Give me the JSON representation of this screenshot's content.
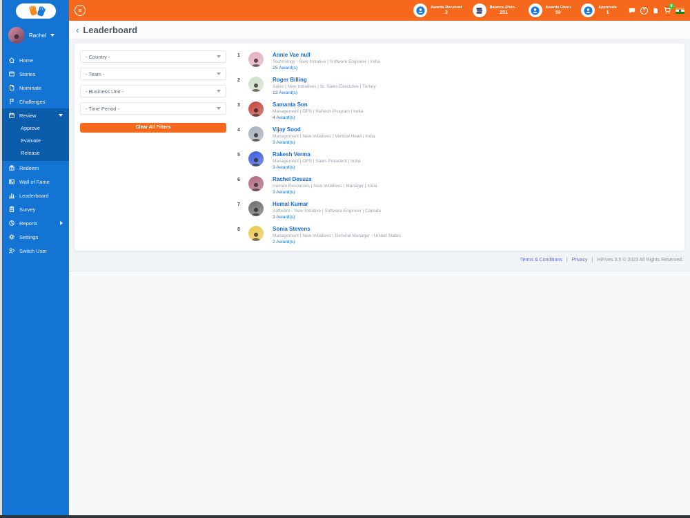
{
  "colors": {
    "accent_orange": "#F6681C",
    "sidebar_blue": "#1474D4",
    "sidebar_active_blue": "#0B5CAB",
    "link_blue": "#1B75D0",
    "page_bg": "#F1F4F7",
    "cart_badge_green": "#2ECC40"
  },
  "sidebar": {
    "user": {
      "name": "Rachel"
    },
    "items": [
      {
        "label": "Home",
        "icon": "home"
      },
      {
        "label": "Stories",
        "icon": "stories"
      },
      {
        "label": "Nominate",
        "icon": "nominate"
      },
      {
        "label": "Challenges",
        "icon": "challenges"
      },
      {
        "label": "Review",
        "icon": "review",
        "expanded": true,
        "children": [
          "Approve",
          "Evaluate",
          "Release"
        ]
      },
      {
        "label": "Redeem",
        "icon": "redeem"
      },
      {
        "label": "Wall of Fame",
        "icon": "wall-of-fame"
      },
      {
        "label": "Leaderboard",
        "icon": "leaderboard"
      },
      {
        "label": "Survey",
        "icon": "survey"
      },
      {
        "label": "Reports",
        "icon": "reports",
        "has_submenu": true
      },
      {
        "label": "Settings",
        "icon": "settings"
      },
      {
        "label": "Switch User",
        "icon": "switch-user"
      }
    ]
  },
  "topbar": {
    "stats": [
      {
        "label": "Awards Received",
        "value": "3",
        "icon": "medal"
      },
      {
        "label": "Balance (Poin...",
        "value": "251",
        "icon": "coins"
      },
      {
        "label": "Awards Given",
        "value": "59",
        "icon": "medal"
      },
      {
        "label": "Approvals",
        "value": "1",
        "icon": "medal"
      }
    ],
    "quick_icons": [
      "chat",
      "help",
      "document",
      "cart",
      "flag-india"
    ],
    "cart_badge": "9"
  },
  "page": {
    "title": "Leaderboard",
    "back_chevron": "‹"
  },
  "filters": {
    "selects": [
      {
        "name": "country",
        "value": "- Country -"
      },
      {
        "name": "team",
        "value": "- Team -"
      },
      {
        "name": "business-unit",
        "value": "- Business Unit -"
      },
      {
        "name": "time-period",
        "value": "- Time Period -"
      }
    ],
    "clear_button": "Clear All Filters"
  },
  "leaderboard": [
    {
      "rank": "1",
      "name": "Annie Vae null",
      "detail": "Technology - New Initiative | Software Engineer | India",
      "awards": "25 Award(s)",
      "avatar_color": "#e3aec2"
    },
    {
      "rank": "2",
      "name": "Roger Billing",
      "detail": "Sales | New Initiatives | Sr. Sales Executive | Turkey",
      "awards": "13 Award(s)",
      "avatar_color": "#cfe0cb"
    },
    {
      "rank": "3",
      "name": "Samanta Son",
      "detail": "Management | OPS | Refresh Program | India",
      "awards": "4 Award(s)",
      "avatar_color": "#c4453c"
    },
    {
      "rank": "4",
      "name": "Vijay Sood",
      "detail": "Management | New Initiatives | Vertical Head | India",
      "awards": "3 Award(s)",
      "avatar_color": "#a6afba"
    },
    {
      "rank": "5",
      "name": "Rakesh Verma",
      "detail": "Management | OPS | Sales President | India",
      "awards": "3 Award(s)",
      "avatar_color": "#3b5bdb"
    },
    {
      "rank": "6",
      "name": "Rachel Desuza",
      "detail": "Human Resources | New Initiatives | Manager | India",
      "awards": "3 Award(s)",
      "avatar_color": "#b06a7c"
    },
    {
      "rank": "7",
      "name": "Hemal Kumar",
      "detail": "Software - New Initiative | Software Engineer | Canada",
      "awards": "3 Award(s)",
      "avatar_color": "#6d6d70"
    },
    {
      "rank": "8",
      "name": "Sonia Stevens",
      "detail": "Management | New Initiatives | General Manager - United States",
      "awards": "2 Award(s)",
      "avatar_color": "#e9c94f"
    }
  ],
  "footer": {
    "links": [
      "Terms & Conditions",
      "Privacy"
    ],
    "separator": "|",
    "copyright": "HiFives 3.5 © 2023 All Rights Reserved."
  }
}
